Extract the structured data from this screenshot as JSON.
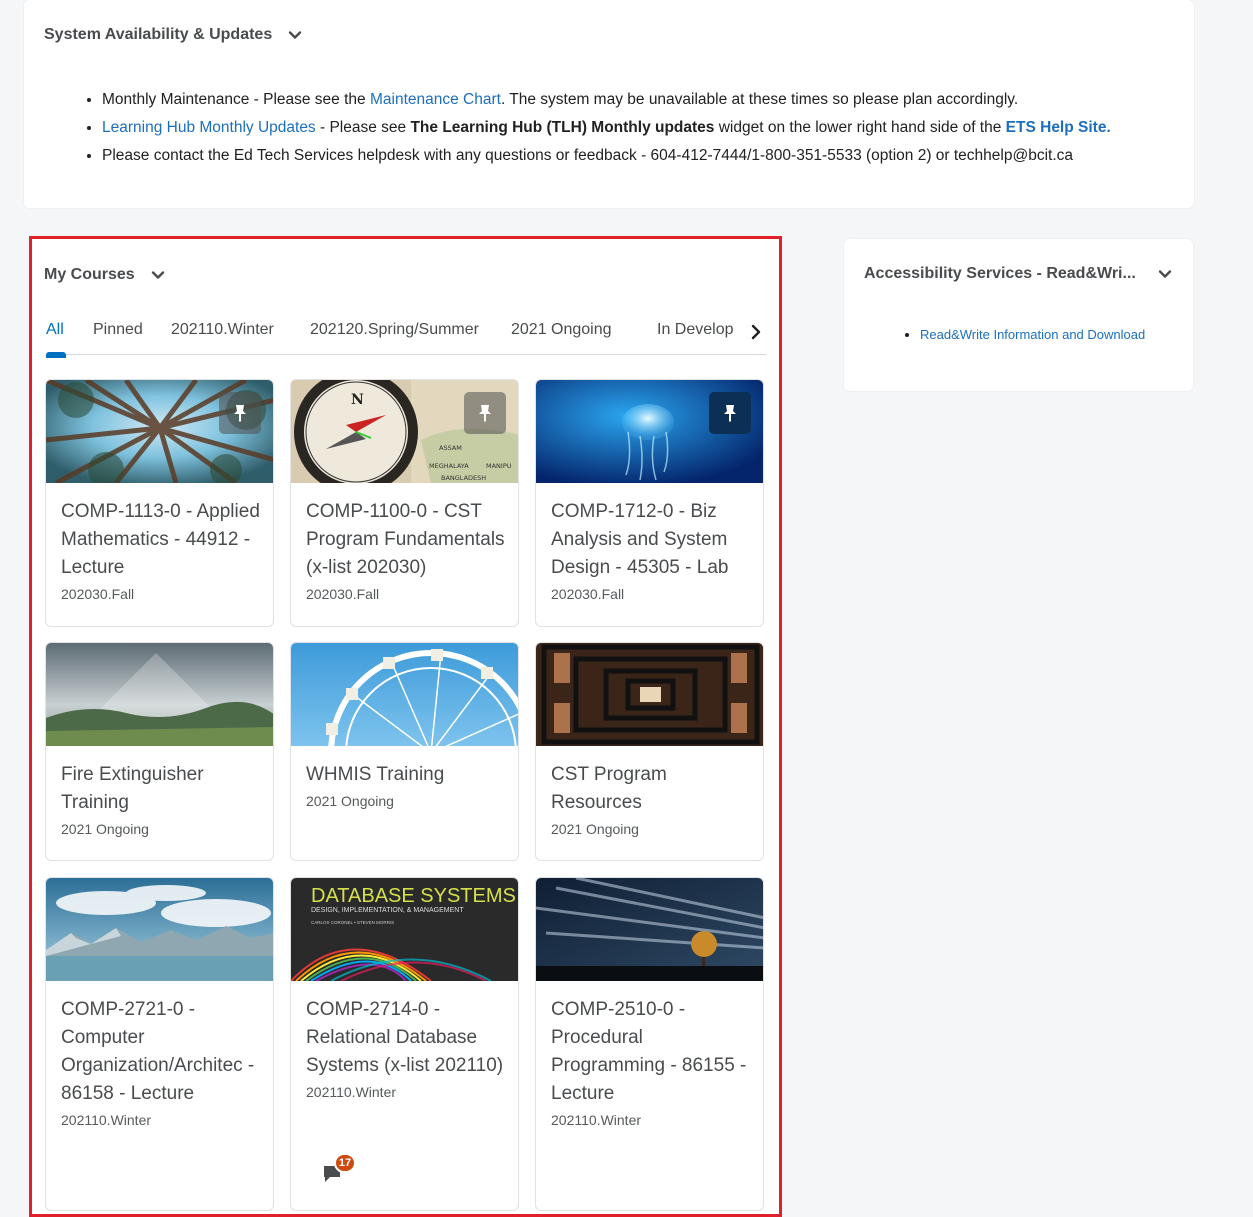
{
  "system_widget": {
    "title": "System Availability & Updates",
    "line1": {
      "prefix": "Monthly Maintenance - Please see the ",
      "link": "Maintenance Chart",
      "suffix": ". The system may be unavailable at these times so please plan accordingly."
    },
    "line2": {
      "link": "Learning Hub Monthly Updates",
      "mid": " - Please see ",
      "bold": "The Learning Hub (TLH) Monthly updates",
      "mid2": " widget on the lower right hand side of the ",
      "link2": "ETS Help Site."
    },
    "line3": "Please contact the Ed Tech Services helpdesk with any questions or feedback - 604-412-7444/1-800-351-5533 (option 2) or techhelp@bcit.ca"
  },
  "my_courses": {
    "title": "My Courses",
    "tabs": [
      "All",
      "Pinned",
      "202110.Winter",
      "202120.Spring/Summer",
      "2021 Ongoing",
      "In Develop"
    ],
    "courses": [
      {
        "title": "COMP-1113-0 - Applied Mathematics - 44912 - Lecture",
        "term": "202030.Fall",
        "pinned": true,
        "image": "forest-canopy"
      },
      {
        "title": "COMP-1100-0 - CST Program Fundamentals (x-list 202030)",
        "term": "202030.Fall",
        "pinned": true,
        "image": "compass-map",
        "map_labels": [
          "ASSAM",
          "MEGHALAYA",
          "BANGLADESH",
          "MANIPU"
        ]
      },
      {
        "title": "COMP-1712-0 - Biz Analysis and System Design - 45305 - Lab",
        "term": "202030.Fall",
        "pinned": true,
        "image": "jellyfish"
      },
      {
        "title": "Fire Extinguisher Training",
        "term": "2021 Ongoing",
        "pinned": false,
        "image": "valley-sunrays"
      },
      {
        "title": "WHMIS Training",
        "term": "2021 Ongoing",
        "pinned": false,
        "image": "ferris-wheel"
      },
      {
        "title": "CST Program Resources",
        "term": "2021 Ongoing",
        "pinned": false,
        "image": "tunnel"
      },
      {
        "title": "COMP-2721-0 - Computer Organization/Architec - 86158 - Lecture",
        "term": "202110.Winter",
        "pinned": false,
        "image": "lake-mountains"
      },
      {
        "title": "COMP-2714-0 - Relational Database Systems (x-list 202110)",
        "term": "202110.Winter",
        "pinned": false,
        "image": "database-book",
        "book_title": "DATABASE SYSTEMS",
        "book_subtitle": "DESIGN, IMPLEMENTATION, & MANAGEMENT",
        "book_authors": "CARLOS CORONEL • STEVEN MORRIS",
        "notification_count": "17"
      },
      {
        "title": "COMP-2510-0 - Procedural Programming - 86155 - Lecture",
        "term": "202110.Winter",
        "pinned": false,
        "image": "tree-night-sky"
      }
    ]
  },
  "accessibility_widget": {
    "title": "Accessibility Services - Read&Wri...",
    "link": "Read&Write Information and Download"
  },
  "colors": {
    "link": "#1c6fbd",
    "tab_active": "#006fbf",
    "highlight_frame": "#e0202b",
    "badge": "#cd4b0f"
  }
}
